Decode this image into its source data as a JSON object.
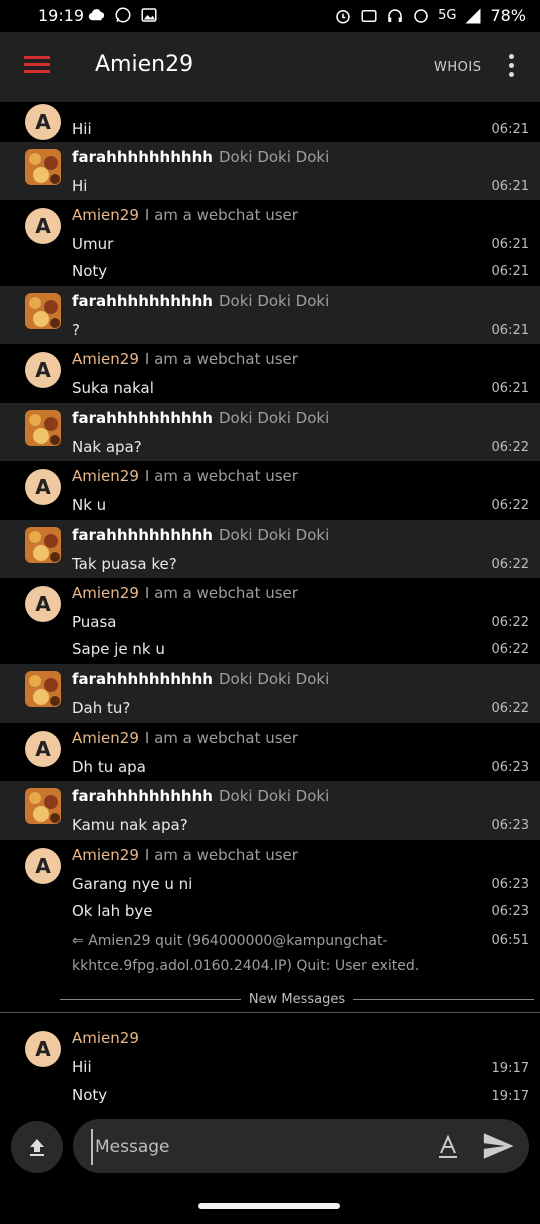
{
  "status_bar": {
    "time": "19:19",
    "network": "5G",
    "battery": "78%"
  },
  "header": {
    "title": "Amien29",
    "whois_label": "WHOIS"
  },
  "colors": {
    "self_nick": "#e8b88a",
    "accent": "#d32f2f",
    "row_dark": "#212121"
  },
  "messages": [
    {
      "nick": "",
      "desc": "",
      "lines": [
        {
          "text": "Hii",
          "time": "06:21"
        }
      ]
    },
    {
      "nick": "farahhhhhhhhhh",
      "desc": "Doki Doki Doki",
      "lines": [
        {
          "text": "Hi",
          "time": "06:21"
        }
      ]
    },
    {
      "nick": "Amien29",
      "desc": "I am a webchat user",
      "lines": [
        {
          "text": "Umur",
          "time": "06:21"
        },
        {
          "text": "Noty",
          "time": "06:21"
        }
      ]
    },
    {
      "nick": "farahhhhhhhhhh",
      "desc": "Doki Doki Doki",
      "lines": [
        {
          "text": "?",
          "time": "06:21"
        }
      ]
    },
    {
      "nick": "Amien29",
      "desc": "I am a webchat user",
      "lines": [
        {
          "text": "Suka nakal",
          "time": "06:21"
        }
      ]
    },
    {
      "nick": "farahhhhhhhhhh",
      "desc": "Doki Doki Doki",
      "lines": [
        {
          "text": "Nak apa?",
          "time": "06:22"
        }
      ]
    },
    {
      "nick": "Amien29",
      "desc": "I am a webchat user",
      "lines": [
        {
          "text": "Nk u",
          "time": "06:22"
        }
      ]
    },
    {
      "nick": "farahhhhhhhhhh",
      "desc": "Doki Doki Doki",
      "lines": [
        {
          "text": "Tak puasa ke?",
          "time": "06:22"
        }
      ]
    },
    {
      "nick": "Amien29",
      "desc": "I am a webchat user",
      "lines": [
        {
          "text": "Puasa",
          "time": "06:22"
        },
        {
          "text": "Sape je nk u",
          "time": "06:22"
        }
      ]
    },
    {
      "nick": "farahhhhhhhhhh",
      "desc": "Doki Doki Doki",
      "lines": [
        {
          "text": "Dah tu?",
          "time": "06:22"
        }
      ]
    },
    {
      "nick": "Amien29",
      "desc": "I am a webchat user",
      "lines": [
        {
          "text": "Dh tu apa",
          "time": "06:23"
        }
      ]
    },
    {
      "nick": "farahhhhhhhhhh",
      "desc": "Doki Doki Doki",
      "lines": [
        {
          "text": "Kamu nak apa?",
          "time": "06:23"
        }
      ]
    },
    {
      "nick": "Amien29",
      "desc": "I am a webchat user",
      "lines": [
        {
          "text": "Garang nye u ni",
          "time": "06:23"
        },
        {
          "text": "Ok lah bye",
          "time": "06:23"
        }
      ]
    }
  ],
  "quit_event": {
    "arrow": "⇐",
    "text": "Amien29 quit (964000000@kampungchat-kkhtce.9fpg.adol.0160.2404.IP) Quit: User exited.",
    "time": "06:51"
  },
  "new_messages_label": "New Messages",
  "latest_group": {
    "nick": "Amien29",
    "lines": [
      {
        "text": "Hii",
        "time": "19:17"
      },
      {
        "text": "Noty",
        "time": "19:17"
      }
    ]
  },
  "avatar_letter": "A",
  "input": {
    "placeholder": "Message",
    "value": ""
  }
}
